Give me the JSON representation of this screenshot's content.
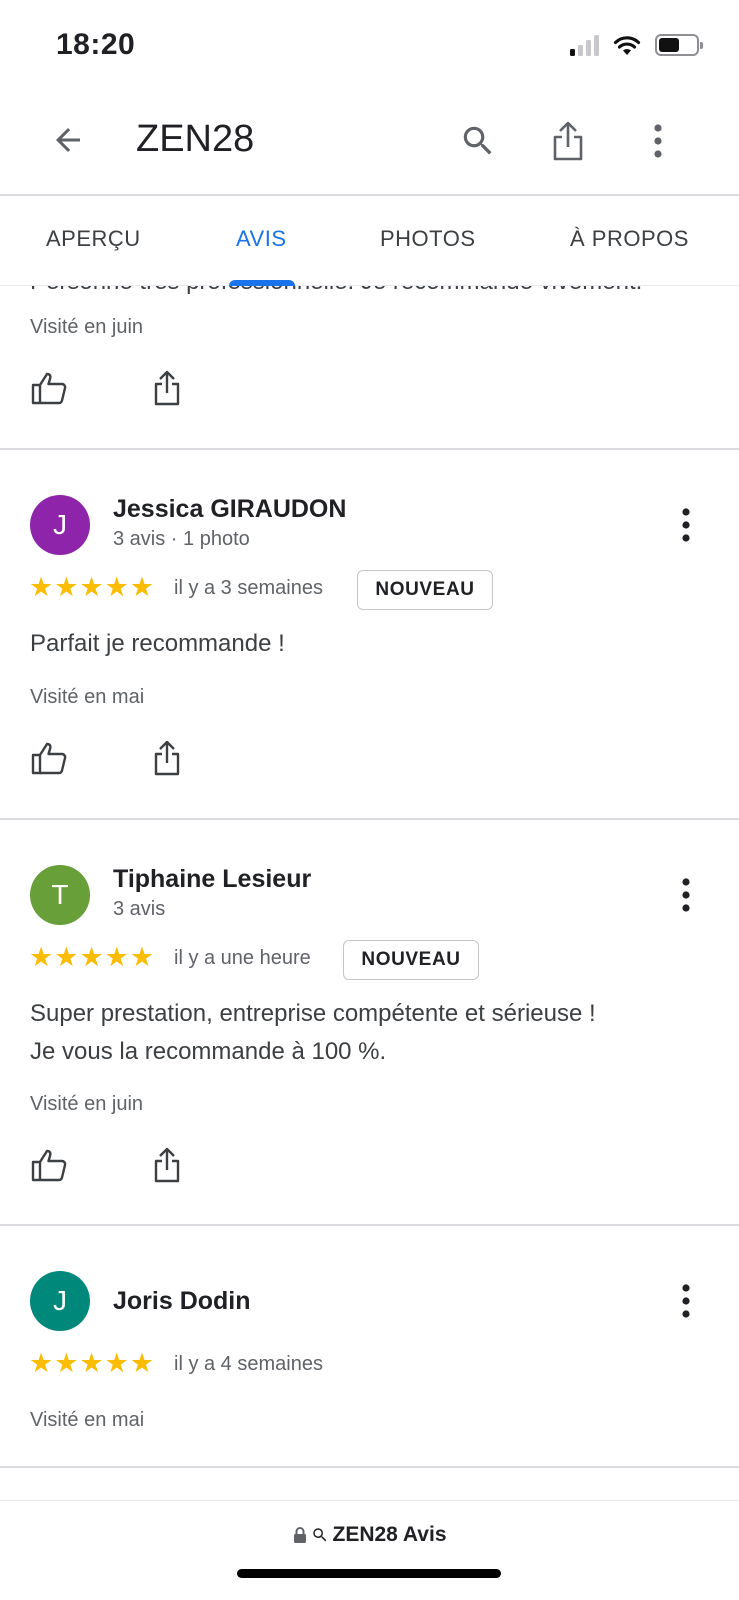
{
  "status_bar": {
    "time": "18:20",
    "icons": [
      "cellular-signal-icon",
      "wifi-icon",
      "battery-icon"
    ],
    "battery_level": 0.55
  },
  "app_bar": {
    "title": "ZEN28",
    "icons": [
      "back-arrow-icon",
      "search-icon",
      "share-icon",
      "more-vert-icon"
    ]
  },
  "tabs": [
    {
      "label": "APERÇU",
      "active": false
    },
    {
      "label": "AVIS",
      "active": true
    },
    {
      "label": "PHOTOS",
      "active": false
    },
    {
      "label": "À PROPOS",
      "active": false
    }
  ],
  "previous_review": {
    "partial_text": "Personne très professionnelle. Je recommande vivement.",
    "visited": "Visité en juin"
  },
  "reviews": [
    {
      "initial": "J",
      "avatar_color": "#8e24aa",
      "name": "Jessica GIRAUDON",
      "meta": "3 avis · 1 photo",
      "rating": 5,
      "time": "il y a 3 semaines",
      "badge": "NOUVEAU",
      "text": "Parfait je recommande !",
      "visited": "Visité en mai"
    },
    {
      "initial": "T",
      "avatar_color": "#689f38",
      "name": "Tiphaine Lesieur",
      "meta": "3 avis",
      "rating": 5,
      "time": "il y a une heure",
      "badge": "NOUVEAU",
      "text_line1": "Super prestation, entreprise compétente et sérieuse !",
      "text_line2": "Je vous la recommande à 100 %.",
      "visited": "Visité en juin"
    },
    {
      "initial": "J",
      "avatar_color": "#00897b",
      "name": "Joris Dodin",
      "rating": 5,
      "time": "il y a 4 semaines",
      "visited": "Visité en mai"
    }
  ],
  "colors": {
    "accent": "#1a73e8",
    "star": "#fbbc04",
    "divider": "#dadce0",
    "secondary_text": "#5f6368"
  },
  "url_bar": {
    "text": "ZEN28 Avis",
    "icons": [
      "lock-icon",
      "search-icon"
    ]
  }
}
